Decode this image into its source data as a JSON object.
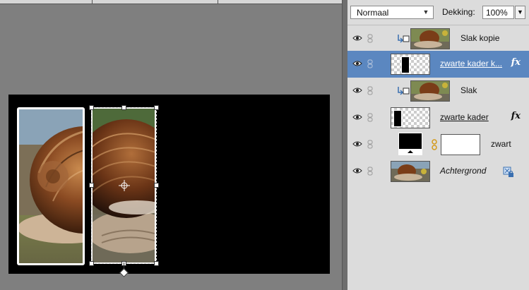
{
  "layers_panel": {
    "blend_mode": "Normaal",
    "opacity_label": "Dekking:",
    "opacity_value": "100%",
    "layers": [
      {
        "name": "Slak kopie",
        "visible": true,
        "clipped": true,
        "selected": false,
        "has_fx": false
      },
      {
        "name": "zwarte kader k...",
        "visible": true,
        "clipped": false,
        "selected": true,
        "has_fx": true
      },
      {
        "name": "Slak",
        "visible": true,
        "clipped": true,
        "selected": false,
        "has_fx": false
      },
      {
        "name": "zwarte kader",
        "visible": true,
        "clipped": false,
        "selected": false,
        "has_fx": true
      },
      {
        "name": "zwart",
        "visible": true,
        "clipped": false,
        "selected": false,
        "has_fx": false,
        "has_mask": true
      },
      {
        "name": "Achtergrond",
        "visible": true,
        "clipped": false,
        "selected": false,
        "has_fx": false,
        "locked": true
      }
    ],
    "fx_label": "fx"
  },
  "icons": {
    "eye": "eye-icon",
    "link": "link-icon",
    "clip": "clipping-mask-icon",
    "fx": "layer-style-fx-icon",
    "lock": "lock-icon"
  },
  "colors": {
    "selected_row": "#5b87c0",
    "panel_bg": "#dcdcdc",
    "canvas_bg": "#7f7f7f",
    "document_bg": "#000000"
  }
}
